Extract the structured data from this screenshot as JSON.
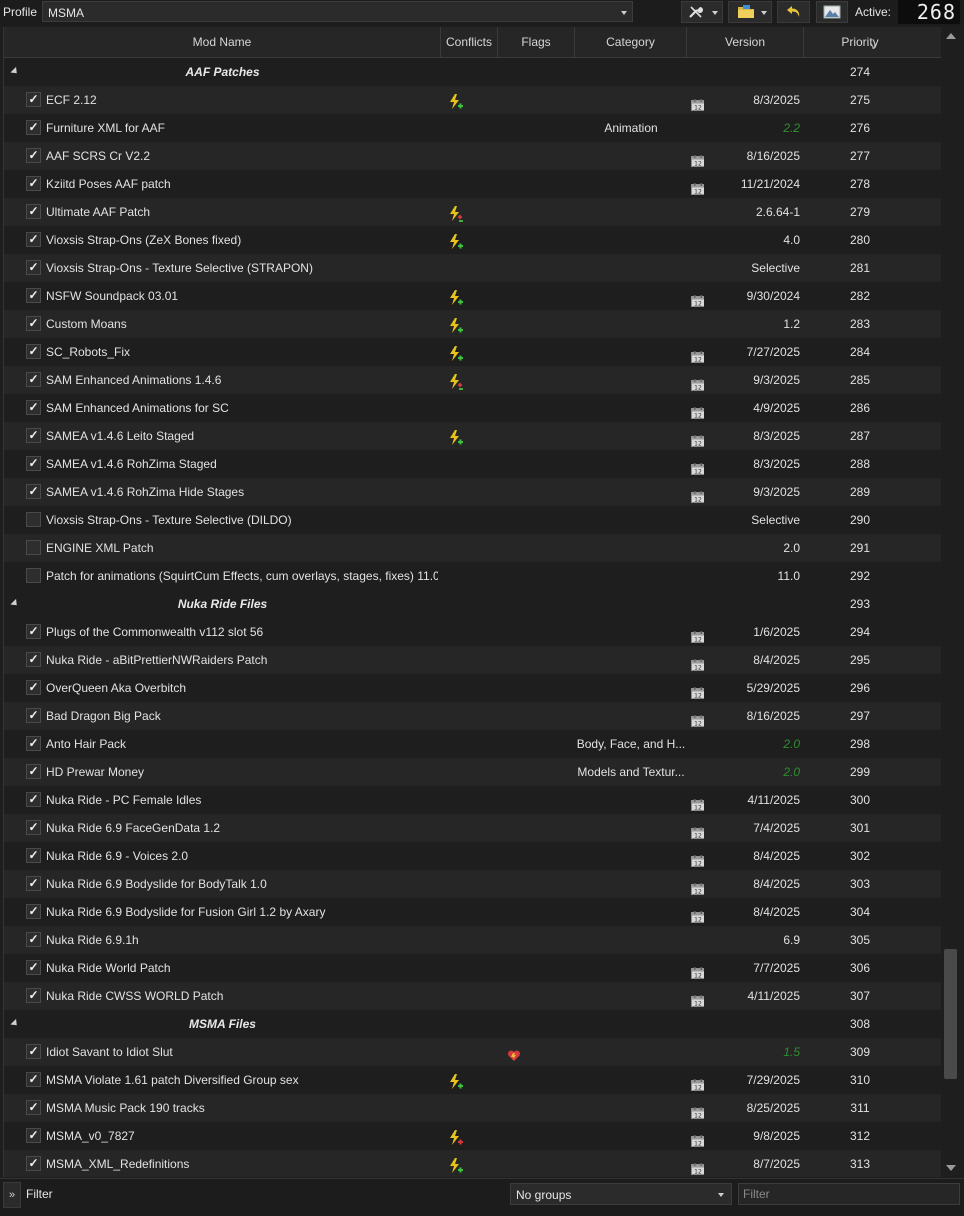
{
  "toolbar": {
    "profile_label": "Profile",
    "profile_value": "MSMA",
    "active_label": "Active:",
    "active_count": "268"
  },
  "columns": {
    "name": "Mod Name",
    "conflicts": "Conflicts",
    "flags": "Flags",
    "category": "Category",
    "version": "Version",
    "priority": "Priority"
  },
  "rows": [
    {
      "type": "separator",
      "name": "AAF Patches",
      "priority": "274"
    },
    {
      "type": "mod",
      "checked": true,
      "name": "ECF 2.12",
      "conflict": "bolt-green",
      "flag": true,
      "category": "",
      "version": "8/3/2025",
      "version_style": "normal",
      "priority": "275"
    },
    {
      "type": "mod",
      "checked": true,
      "name": "Furniture XML for AAF",
      "conflict": "",
      "flag": false,
      "category": "Animation",
      "version": "2.2",
      "version_style": "green",
      "priority": "276"
    },
    {
      "type": "mod",
      "checked": true,
      "name": "AAF SCRS Cr V2.2",
      "conflict": "",
      "flag": true,
      "category": "",
      "version": "8/16/2025",
      "version_style": "normal",
      "priority": "277"
    },
    {
      "type": "mod",
      "checked": true,
      "name": "Kziitd Poses AAF patch",
      "conflict": "",
      "flag": true,
      "category": "",
      "version": "11/21/2024",
      "version_style": "normal",
      "priority": "278"
    },
    {
      "type": "mod",
      "checked": true,
      "name": "Ultimate AAF Patch",
      "conflict": "bolt-mixed",
      "flag": false,
      "category": "",
      "version": "2.6.64-1",
      "version_style": "normal",
      "priority": "279"
    },
    {
      "type": "mod",
      "checked": true,
      "name": "Vioxsis Strap-Ons (ZeX Bones fixed)",
      "conflict": "bolt-green",
      "flag": false,
      "category": "",
      "version": "4.0",
      "version_style": "normal",
      "priority": "280"
    },
    {
      "type": "mod",
      "checked": true,
      "name": "Vioxsis Strap-Ons - Texture Selective (STRAPON)",
      "conflict": "",
      "flag": false,
      "category": "",
      "version": "Selective",
      "version_style": "normal",
      "priority": "281"
    },
    {
      "type": "mod",
      "checked": true,
      "name": "NSFW Soundpack 03.01",
      "conflict": "bolt-green",
      "flag": true,
      "category": "",
      "version": "9/30/2024",
      "version_style": "normal",
      "priority": "282"
    },
    {
      "type": "mod",
      "checked": true,
      "name": "Custom Moans",
      "conflict": "bolt-green",
      "flag": false,
      "category": "",
      "version": "1.2",
      "version_style": "normal",
      "priority": "283"
    },
    {
      "type": "mod",
      "checked": true,
      "name": "SC_Robots_Fix",
      "conflict": "bolt-green",
      "flag": true,
      "category": "",
      "version": "7/27/2025",
      "version_style": "normal",
      "priority": "284"
    },
    {
      "type": "mod",
      "checked": true,
      "name": "SAM Enhanced Animations 1.4.6",
      "conflict": "bolt-mixed",
      "flag": true,
      "category": "",
      "version": "9/3/2025",
      "version_style": "normal",
      "priority": "285"
    },
    {
      "type": "mod",
      "checked": true,
      "name": "SAM Enhanced Animations for SC",
      "conflict": "",
      "flag": true,
      "category": "",
      "version": "4/9/2025",
      "version_style": "normal",
      "priority": "286"
    },
    {
      "type": "mod",
      "checked": true,
      "name": "SAMEA v1.4.6 Leito Staged",
      "conflict": "bolt-green",
      "flag": true,
      "category": "",
      "version": "8/3/2025",
      "version_style": "normal",
      "priority": "287"
    },
    {
      "type": "mod",
      "checked": true,
      "name": "SAMEA v1.4.6 RohZima Staged",
      "conflict": "",
      "flag": true,
      "category": "",
      "version": "8/3/2025",
      "version_style": "normal",
      "priority": "288"
    },
    {
      "type": "mod",
      "checked": true,
      "name": "SAMEA v1.4.6 RohZima Hide Stages",
      "conflict": "",
      "flag": true,
      "category": "",
      "version": "9/3/2025",
      "version_style": "normal",
      "priority": "289"
    },
    {
      "type": "mod",
      "checked": false,
      "name": "Vioxsis Strap-Ons - Texture Selective (DILDO)",
      "conflict": "",
      "flag": false,
      "category": "",
      "version": "Selective",
      "version_style": "normal",
      "priority": "290"
    },
    {
      "type": "mod",
      "checked": false,
      "name": "ENGINE XML Patch",
      "conflict": "",
      "flag": false,
      "category": "",
      "version": "2.0",
      "version_style": "normal",
      "priority": "291"
    },
    {
      "type": "mod",
      "checked": false,
      "name": "Patch for animations (SquirtCum Effects, cum overlays, stages, fixes) 11.0",
      "conflict": "",
      "flag": false,
      "category": "",
      "version": "11.0",
      "version_style": "normal",
      "priority": "292"
    },
    {
      "type": "separator",
      "name": "Nuka Ride Files",
      "priority": "293"
    },
    {
      "type": "mod",
      "checked": true,
      "name": "Plugs of the Commonwealth v112 slot 56",
      "conflict": "",
      "flag": true,
      "category": "",
      "version": "1/6/2025",
      "version_style": "normal",
      "priority": "294"
    },
    {
      "type": "mod",
      "checked": true,
      "name": "Nuka Ride - aBitPrettierNWRaiders Patch",
      "conflict": "",
      "flag": true,
      "category": "",
      "version": "8/4/2025",
      "version_style": "normal",
      "priority": "295"
    },
    {
      "type": "mod",
      "checked": true,
      "name": "OverQueen Aka Overbitch",
      "conflict": "",
      "flag": true,
      "category": "",
      "version": "5/29/2025",
      "version_style": "normal",
      "priority": "296"
    },
    {
      "type": "mod",
      "checked": true,
      "name": "Bad Dragon Big Pack",
      "conflict": "",
      "flag": true,
      "category": "",
      "version": "8/16/2025",
      "version_style": "normal",
      "priority": "297"
    },
    {
      "type": "mod",
      "checked": true,
      "name": "Anto Hair Pack",
      "conflict": "",
      "flag": false,
      "category": "Body, Face, and H...",
      "version": "2.0",
      "version_style": "green",
      "priority": "298"
    },
    {
      "type": "mod",
      "checked": true,
      "name": "HD Prewar Money",
      "conflict": "",
      "flag": false,
      "category": "Models and Textur...",
      "version": "2.0",
      "version_style": "green",
      "priority": "299"
    },
    {
      "type": "mod",
      "checked": true,
      "name": "Nuka Ride - PC Female Idles",
      "conflict": "",
      "flag": true,
      "category": "",
      "version": "4/11/2025",
      "version_style": "normal",
      "priority": "300"
    },
    {
      "type": "mod",
      "checked": true,
      "name": "Nuka Ride 6.9 FaceGenData 1.2",
      "conflict": "",
      "flag": true,
      "category": "",
      "version": "7/4/2025",
      "version_style": "normal",
      "priority": "301"
    },
    {
      "type": "mod",
      "checked": true,
      "name": "Nuka Ride 6.9 - Voices 2.0",
      "conflict": "",
      "flag": true,
      "category": "",
      "version": "8/4/2025",
      "version_style": "normal",
      "priority": "302"
    },
    {
      "type": "mod",
      "checked": true,
      "name": "Nuka Ride 6.9 Bodyslide for BodyTalk 1.0",
      "conflict": "",
      "flag": true,
      "category": "",
      "version": "8/4/2025",
      "version_style": "normal",
      "priority": "303"
    },
    {
      "type": "mod",
      "checked": true,
      "name": "Nuka Ride 6.9 Bodyslide for Fusion Girl 1.2 by Axary",
      "conflict": "",
      "flag": true,
      "category": "",
      "version": "8/4/2025",
      "version_style": "normal",
      "priority": "304"
    },
    {
      "type": "mod",
      "checked": true,
      "name": "Nuka Ride 6.9.1h",
      "conflict": "",
      "flag": false,
      "category": "",
      "version": "6.9",
      "version_style": "normal",
      "priority": "305"
    },
    {
      "type": "mod",
      "checked": true,
      "name": "Nuka Ride World Patch",
      "conflict": "",
      "flag": true,
      "category": "",
      "version": "7/7/2025",
      "version_style": "normal",
      "priority": "306"
    },
    {
      "type": "mod",
      "checked": true,
      "name": "Nuka Ride CWSS WORLD Patch",
      "conflict": "",
      "flag": true,
      "category": "",
      "version": "4/11/2025",
      "version_style": "normal",
      "priority": "307"
    },
    {
      "type": "separator",
      "name": "MSMA Files",
      "priority": "308"
    },
    {
      "type": "mod",
      "checked": true,
      "name": "Idiot Savant to Idiot Slut",
      "conflict": "heart",
      "flag": false,
      "category": "",
      "version": "1.5",
      "version_style": "green",
      "priority": "309"
    },
    {
      "type": "mod",
      "checked": true,
      "name": "MSMA Violate 1.61 patch Diversified Group sex",
      "conflict": "bolt-green",
      "flag": true,
      "category": "",
      "version": "7/29/2025",
      "version_style": "normal",
      "priority": "310"
    },
    {
      "type": "mod",
      "checked": true,
      "name": "MSMA Music Pack 190 tracks",
      "conflict": "",
      "flag": true,
      "category": "",
      "version": "8/25/2025",
      "version_style": "normal",
      "priority": "311"
    },
    {
      "type": "mod",
      "checked": true,
      "name": "MSMA_v0_7827",
      "conflict": "bolt-red",
      "flag": true,
      "category": "",
      "version": "9/8/2025",
      "version_style": "normal",
      "priority": "312"
    },
    {
      "type": "mod",
      "checked": true,
      "name": "MSMA_XML_Redefinitions",
      "conflict": "bolt-green",
      "flag": true,
      "category": "",
      "version": "8/7/2025",
      "version_style": "normal",
      "priority": "313"
    }
  ],
  "bottombar": {
    "expand_glyph": "»",
    "filter_label": "Filter",
    "groups_value": "No groups",
    "filter_placeholder": "Filter"
  },
  "colors": {
    "bolt_yellow": "#e8c21c",
    "conflict_green": "#3fbf3f",
    "conflict_red": "#d03a3a",
    "version_green": "#2f8f2f"
  }
}
